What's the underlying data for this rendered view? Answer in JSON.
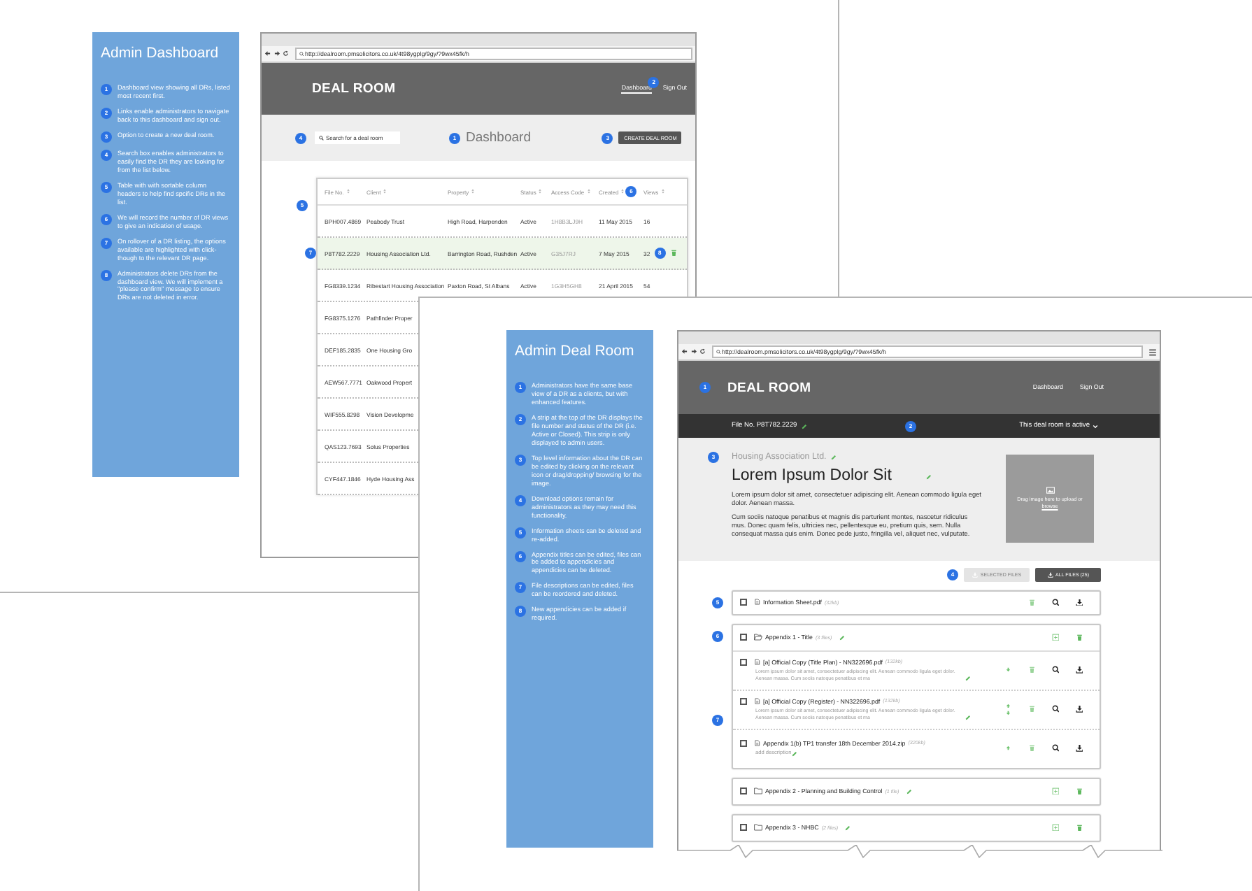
{
  "dashboard_sheet": {
    "panel": {
      "title": "Admin Dashboard",
      "notes": [
        {
          "number": "1",
          "text": "Dashboard view showing all DRs, listed most recent first."
        },
        {
          "number": "2",
          "text": "Links enable administrators to navigate back to this dashboard and sign out."
        },
        {
          "number": "3",
          "text": "Option to create a new deal room."
        },
        {
          "number": "4",
          "text": "Search box enables administrators to easily find the DR they are looking for from the list below."
        },
        {
          "number": "5",
          "text": "Table with with sortable column headers to help find spcific DRs in the list."
        },
        {
          "number": "6",
          "text": "We will record the number of DR views to give an indication of usage."
        },
        {
          "number": "7",
          "text": "On rollover of a DR listing, the options available are highlighted with click-though to the relevant DR page."
        },
        {
          "number": "8",
          "text": "Administrators delete DRs from the dashboard view. We will implement a \"please confirm\" message to ensure DRs are not deleted in error."
        }
      ]
    },
    "browser": {
      "url": "http://dealroom.pmsolicitors.co.uk/4t98ygplg/9gy/?9wx45fk/h",
      "brand": "DEAL ROOM",
      "nav": [
        {
          "label": "Dashboard",
          "selected": true
        },
        {
          "label": "Sign Out",
          "selected": false
        }
      ],
      "nav_marker": "2",
      "search": {
        "placeholder": "Search for a deal room",
        "marker": "4"
      },
      "page_title": {
        "text": "Dashboard",
        "marker": "1"
      },
      "create_button": {
        "label": "CREATE DEAL ROOM",
        "marker": "3"
      },
      "table": {
        "marker": "5",
        "columns": [
          {
            "label": "File No."
          },
          {
            "label": "Client"
          },
          {
            "label": "Property"
          },
          {
            "label": "Status"
          },
          {
            "label": "Access Code"
          },
          {
            "label": "Created",
            "marker": "6"
          },
          {
            "label": "Views"
          }
        ],
        "rows": [
          {
            "selected": false,
            "cells": [
              "BPH007.4869",
              "Peabody Trust",
              "High Road, Harpenden",
              "Active",
              "1H8B3LJ9H",
              "11 May 2015",
              "16"
            ]
          },
          {
            "selected": true,
            "marker": "7",
            "action_marker": "8",
            "cells": [
              "P8T782.2229",
              "Housing Association Ltd.",
              "Barrington Road, Rushden",
              "Active",
              "G35J7RJ",
              "7 May 2015",
              "32"
            ]
          },
          {
            "selected": false,
            "cells": [
              "FG8339.1234",
              "Ribestart Housing Association",
              "Paxton Road, St Albans",
              "Active",
              "1G3H5GH8",
              "21 April 2015",
              "54"
            ]
          },
          {
            "selected": false,
            "cells": [
              "FG8375.1276",
              "Pathfinder Proper"
            ]
          },
          {
            "selected": false,
            "cells": [
              "DEF185.2835",
              "One Housing Gro"
            ]
          },
          {
            "selected": false,
            "cells": [
              "AEW567.7771",
              "Oakwood Propert"
            ]
          },
          {
            "selected": false,
            "cells": [
              "WIF555.8298",
              "Vision Developme"
            ]
          },
          {
            "selected": false,
            "cells": [
              "QAS123.7693",
              "Solus Properties"
            ]
          },
          {
            "selected": false,
            "cells": [
              "CYF447.1846",
              "Hyde Housing Ass"
            ]
          }
        ]
      }
    }
  },
  "deal_room_sheet": {
    "panel": {
      "title": "Admin Deal Room",
      "notes": [
        {
          "number": "1",
          "text": "Administrators have the same base view of a DR as a clients, but with enhanced features."
        },
        {
          "number": "2",
          "text": "A strip at the top of the DR displays the file number and status of the DR (i.e. Active or Closed). This strip is only displayed to admin users."
        },
        {
          "number": "3",
          "text": "Top level information about the DR can be edited by clicking on the relevant icon or drag/dropping/ browsing for the image."
        },
        {
          "number": "4",
          "text": "Download options remain for administrators as they may need this functionality."
        },
        {
          "number": "5",
          "text": "Information sheets can be deleted and re-added."
        },
        {
          "number": "6",
          "text": "Appendix titles can be edited, files can be added to appendicies and appendicies can be deleted."
        },
        {
          "number": "7",
          "text": "File descriptions can be edited, files can be reordered and deleted."
        },
        {
          "number": "8",
          "text": "New appendicies can be added if required."
        }
      ]
    },
    "browser": {
      "url": "http://dealroom.pmsolicitors.co.uk/4t98ygplg/9gy/?9wx45fk/h",
      "brand": "DEAL ROOM",
      "brand_marker": "1",
      "nav": [
        {
          "label": "Dashboard"
        },
        {
          "label": "Sign Out"
        }
      ],
      "strip": {
        "file_no": "File No. P8T782.2229",
        "marker": "2",
        "status": "This deal room is active"
      },
      "info": {
        "marker": "3",
        "client": "Housing Association Ltd.",
        "title": "Lorem Ipsum Dolor Sit",
        "paragraphs": [
          "Lorem ipsum dolor sit amet, consectetuer adipiscing elit. Aenean commodo ligula eget dolor. Aenean massa.",
          "Cum sociis natoque penatibus et magnis dis parturient montes, nascetur ridiculus mus. Donec quam felis, ultricies nec, pellentesque eu, pretium quis, sem. Nulla consequat massa quis enim. Donec pede justo, fringilla vel, aliquet nec, vulputate."
        ],
        "upload_hint": "Drag image here to upload or ",
        "upload_link": "browse"
      },
      "downloads": {
        "marker": "4",
        "buttons": [
          {
            "label": "SELECTED FILES",
            "disabled": true
          },
          {
            "label": "ALL FILES (25)",
            "disabled": false
          }
        ]
      },
      "info_sheet": {
        "marker": "5",
        "checked": false,
        "name": "Information Sheet.pdf",
        "size": "(32kb)"
      },
      "appendices": [
        {
          "title": "Appendix 1 - Title",
          "count": "(3 files)",
          "checked": false,
          "expanded": true,
          "marker": "6",
          "files_marker": "7",
          "files": [
            {
              "checked": false,
              "name": "[a] Official Copy (Title Plan) - NN322696.pdf",
              "size": "(132kb)",
              "description": "Lorem ipsum dolor sit amet, consectetuer adipiscing elit. Aenean commodo ligula eget dolor. Aenean massa. Cum sociis natoque penatibus et ma",
              "move_up": false,
              "move_down": true
            },
            {
              "checked": false,
              "name": "[a] Official Copy (Register) - NN322696.pdf",
              "size": "(132kb)",
              "description": "Lorem ipsum dolor sit amet, consectetuer adipiscing elit. Aenean commodo ligula eget dolor. Aenean massa. Cum sociis natoque penatibus et ma",
              "move_up": true,
              "move_down": true
            },
            {
              "checked": false,
              "name": "Appendix 1(b) TP1 transfer 18th December 2014.zip",
              "size": "(320kb)",
              "placeholder": "add description",
              "move_up": true,
              "move_down": false
            }
          ]
        },
        {
          "title": "Appendix 2 - Planning and Building Control",
          "count": "(1 file)",
          "checked": false,
          "expanded": false
        },
        {
          "title": "Appendix 3 - NHBC",
          "count": "(2 files)",
          "checked": false,
          "expanded": false
        }
      ]
    }
  }
}
